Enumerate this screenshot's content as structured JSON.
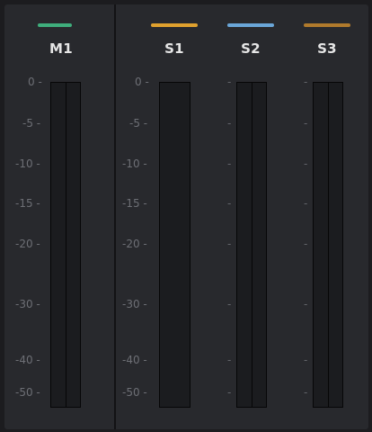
{
  "channels": [
    {
      "id": "m1",
      "label": "M1",
      "color": "#3fae7c"
    },
    {
      "id": "s1",
      "label": "S1",
      "color": "#e0a12e"
    },
    {
      "id": "s2",
      "label": "S2",
      "color": "#6aa6d8"
    },
    {
      "id": "s3",
      "label": "S3",
      "color": "#b07a2c"
    }
  ],
  "scale": {
    "tick_labels": [
      "0 -",
      "-5 -",
      "-10 -",
      "-15 -",
      "-20 -",
      "-30 -",
      "-40 -",
      "-50 -"
    ],
    "tick_dash": "-"
  }
}
